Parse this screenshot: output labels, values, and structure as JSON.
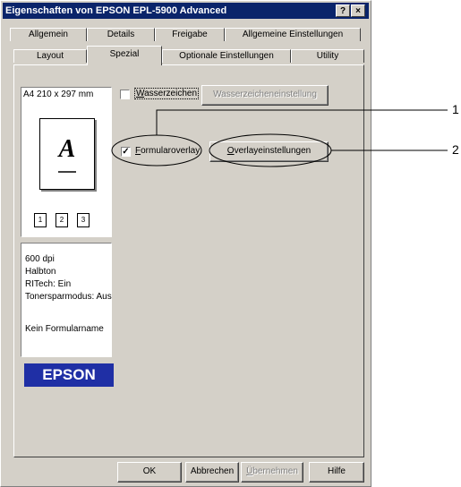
{
  "window": {
    "title": "Eigenschaften von EPSON EPL-5900 Advanced",
    "help_button": "?",
    "close_button": "×"
  },
  "tabs_row1": [
    "Allgemein",
    "Details",
    "Freigabe",
    "Allgemeine Einstellungen"
  ],
  "tabs_row2": [
    "Layout",
    "Spezial",
    "Optionale Einstellungen",
    "Utility"
  ],
  "active_tab": "Spezial",
  "preview": {
    "paper": "A4 210 x 297 mm",
    "letter": "A",
    "page_icons": [
      "1",
      "2",
      "3"
    ]
  },
  "info": {
    "lines": [
      "600 dpi",
      "Halbton",
      "RITech: Ein",
      "Tonersparmodus: Aus",
      "",
      "Kein Formularname"
    ]
  },
  "brand": {
    "logo_text": "EPSON",
    "color": "#1f2fa5"
  },
  "options": {
    "watermark": {
      "label_u": "W",
      "label_rest": "asserzeichen",
      "checked": false
    },
    "watermark_settings": "Wasserzeicheneinstellung",
    "overlay": {
      "label_u": "F",
      "label_rest": "ormularoverlay",
      "checked": true,
      "mark": "✓"
    },
    "overlay_settings": {
      "label_u": "O",
      "label_rest": "verlayeinstellungen"
    }
  },
  "callouts": [
    "1",
    "2"
  ],
  "footer": {
    "ok": "OK",
    "cancel": "Abbrechen",
    "apply_u": "Ü",
    "apply_rest": "bernehmen",
    "help": "Hilfe"
  }
}
